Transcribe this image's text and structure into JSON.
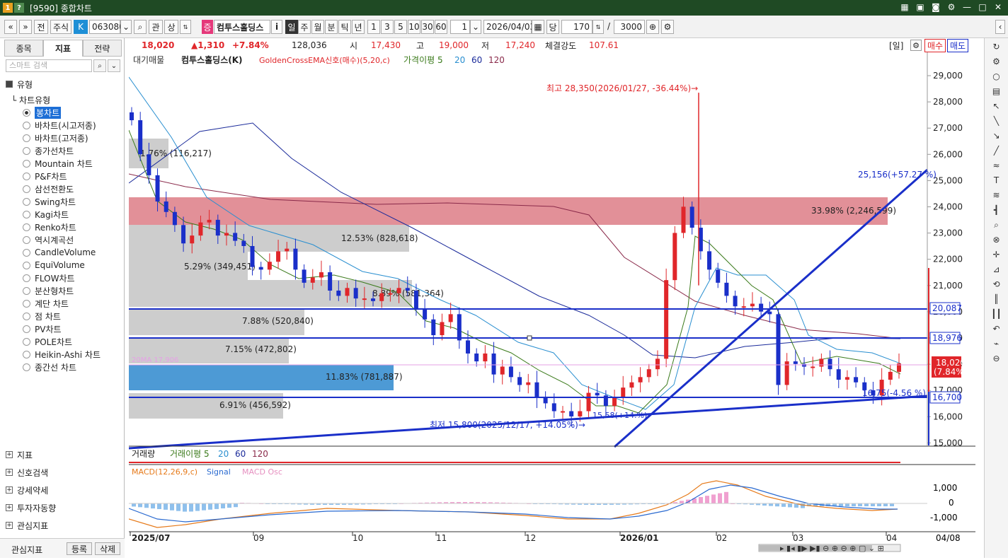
{
  "window": {
    "icon_a": "1",
    "icon_b": "?",
    "title": "[9590] 종합차트"
  },
  "toolbar": {
    "nav_prev": "«",
    "nav_down": "»",
    "type_jeon": "전",
    "market": "주식",
    "k_badge": "K",
    "code": "063080",
    "search_icon": "⌕",
    "btn_gwan": "관",
    "btn_sang": "상",
    "stock_badge": "증",
    "stock_name": "컴투스홀딩스",
    "btn_i": "i",
    "period_day": "일",
    "period_week": "주",
    "period_min": "월",
    "period_bun": "분",
    "period_tick": "틱",
    "period_year": "년",
    "intervals": [
      "1",
      "3",
      "5",
      "10",
      "30",
      "60"
    ],
    "count_sel": "1",
    "date": "2026/04/03",
    "btn_dang": "당",
    "bars": "170",
    "slash": "/",
    "total": "3000"
  },
  "sidebar": {
    "tabs": [
      "종목",
      "지표",
      "전략"
    ],
    "active_tab": "지표",
    "search_placeholder": "스마트 검색",
    "section_type": "유형",
    "tree_root": "차트유형",
    "chart_types": [
      "봉차트",
      "바차트(시고저종)",
      "바차트(고저종)",
      "종가선차트",
      "Mountain 차트",
      "P&F차트",
      "삼선전환도",
      "Swing차트",
      "Kagi차트",
      "Renko차트",
      "역시계곡선",
      "CandleVolume",
      "EquiVolume",
      "FLOW차트",
      "분산형차트",
      "계단 차트",
      "점 차트",
      "PV차트",
      "POLE차트",
      "Heikin-Ashi 차트",
      "종간선 차트"
    ],
    "selected_type": "봉차트",
    "bottom_sections": [
      "지표",
      "신호검색",
      "강세약세",
      "투자자동향",
      "관심지표"
    ],
    "footer_label": "관심지표",
    "btn_register": "등록",
    "btn_delete": "삭제"
  },
  "info": {
    "price": "18,020",
    "change": "▲1,310",
    "pct": "+7.84%",
    "volume": "128,036",
    "open_label": "시",
    "open": "17,430",
    "high_label": "고",
    "high": "19,000",
    "low_label": "저",
    "low": "17,240",
    "strength_label": "체결강도",
    "strength": "107.61",
    "period_tag": "[일]",
    "buy": "매수",
    "sell": "매도"
  },
  "legend": {
    "main": "대기매물",
    "name": "컴투스홀딩스(K)",
    "gc": "GoldenCrossEMA신호(매수)(5,20,c)",
    "ma5": "가격이평 5",
    "ma20": "20",
    "ma60": "60",
    "ma120": "120"
  },
  "vol_legend": {
    "title": "거래량",
    "ma5": "거래이평 5",
    "ma20": "20",
    "ma60": "60",
    "ma120": "120"
  },
  "macd_legend": {
    "macd": "MACD(12,26,9,c)",
    "signal": "Signal",
    "osc": "MACD Osc"
  },
  "annotations": {
    "high": "최고 28,350(2026/01/27, -36.44%)→",
    "low": "최저 15,800(2025/12/17, +14.05%)→",
    "target": "25,156(+57.27 %)",
    "support": "16,75(-4.56 %)",
    "ma20": "20MA 17,906",
    "lowbar": "15,58(+14.%)"
  },
  "profile": [
    {
      "label": "1.76% (116,217)"
    },
    {
      "label": "33.98% (2,246,599)"
    },
    {
      "label": "12.53% (828,618)"
    },
    {
      "label": "5.29% (349,451)"
    },
    {
      "label": "8.89% (581,364)"
    },
    {
      "label": "7.88% (520,840)"
    },
    {
      "label": "7.15% (472,802)"
    },
    {
      "label": "11.83% (781,887)"
    },
    {
      "label": "6.91% (456,592)"
    }
  ],
  "price_axis": [
    "29,000",
    "28,000",
    "27,000",
    "26,000",
    "25,000",
    "24,000",
    "23,000",
    "22,000",
    "21,000",
    "20,000",
    "19,000",
    "18,000",
    "17,000",
    "16,000",
    "15,000"
  ],
  "line_tags": {
    "l1": "20,087",
    "l2": "18,976",
    "l3": "16,700",
    "cur1": "18,020",
    "cur2": "(7.84%)"
  },
  "macd_axis": [
    "1,000",
    "0",
    "-1,000"
  ],
  "dates": [
    "2025/07",
    "09",
    "10",
    "11",
    "12",
    "2026/01",
    "02",
    "03",
    "04"
  ],
  "date_right": "04/08",
  "colors": {
    "up": "#e0262a",
    "down": "#1a2fc9",
    "title_bg": "#1f4a24",
    "profile_hi": "#e08a92",
    "profile": "#c8c8c8",
    "profile_blue": "#3a8fd0"
  },
  "chart_data": {
    "type": "candlestick",
    "x_range": [
      "2025/07",
      "2026/04"
    ],
    "y_range": [
      15000,
      29000
    ],
    "high": 28350,
    "low": 15800,
    "last": 18020,
    "hlines": [
      20087,
      18976,
      16700
    ]
  }
}
